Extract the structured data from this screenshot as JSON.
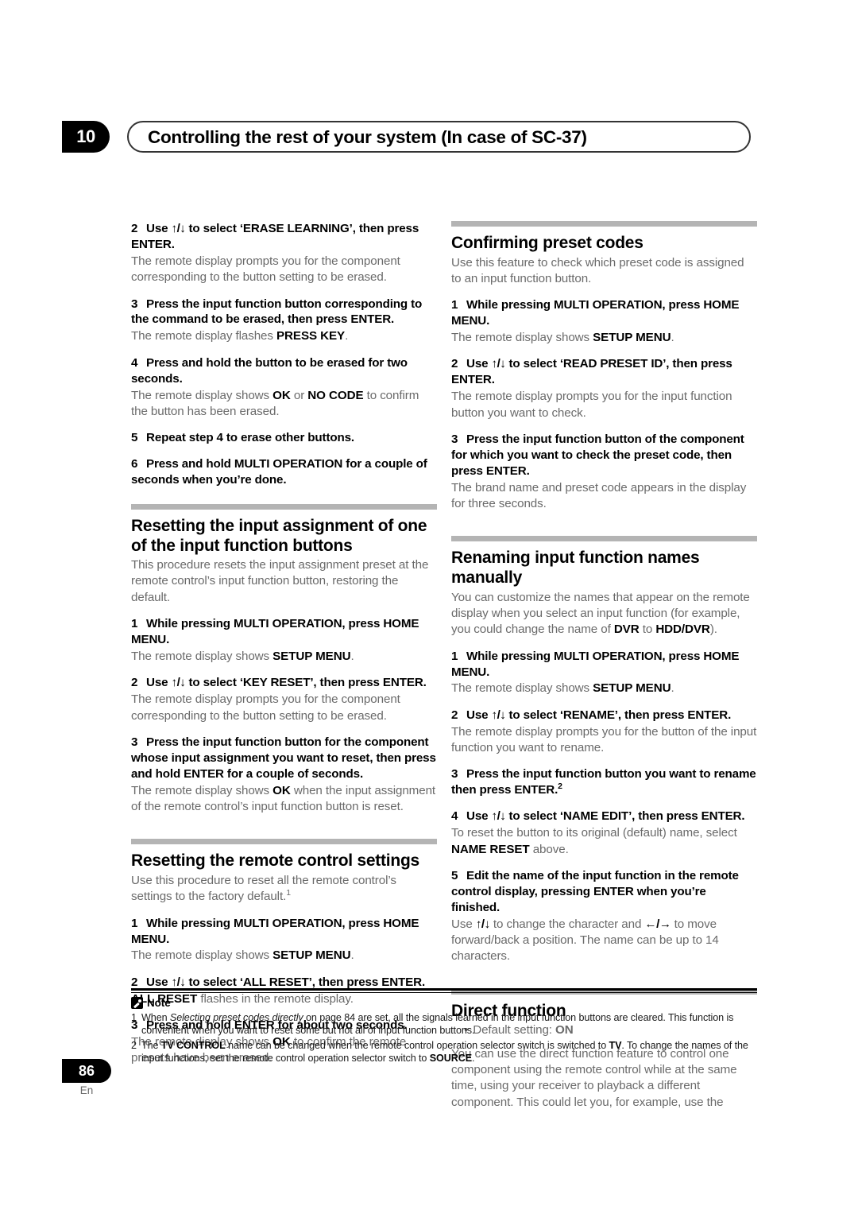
{
  "header": {
    "chapter_number": "10",
    "title": "Controlling the rest of your system (In case of SC-37)"
  },
  "left_column": {
    "steps_continued": [
      {
        "num": "2",
        "title_pre": "Use ",
        "arrows": "↑/↓",
        "title_post": " to select ‘ERASE LEARNING’, then press ENTER.",
        "body": "The remote display prompts you for the component corresponding to the button setting to be erased."
      },
      {
        "num": "3",
        "title": "Press the input function button corresponding to the command to be erased, then press ENTER.",
        "body_pre": "The remote display flashes ",
        "body_bold": "PRESS KEY",
        "body_post": "."
      },
      {
        "num": "4",
        "title": "Press and hold the button to be erased for two seconds.",
        "body_pre": "The remote display shows ",
        "body_bold1": "OK",
        "body_mid": " or ",
        "body_bold2": "NO CODE",
        "body_post": " to confirm the button has been erased."
      },
      {
        "num": "5",
        "title": "Repeat step 4 to erase other buttons."
      },
      {
        "num": "6",
        "title": "Press and hold MULTI OPERATION for a couple of seconds when you’re done."
      }
    ],
    "section_reset_input": {
      "title": "Resetting the input assignment of one of the input function buttons",
      "intro": "This procedure resets the input assignment preset at the remote control’s input function button, restoring the default.",
      "steps": [
        {
          "num": "1",
          "title": "While pressing MULTI OPERATION, press HOME MENU.",
          "body_pre": "The remote display shows ",
          "body_bold": "SETUP MENU",
          "body_post": "."
        },
        {
          "num": "2",
          "title_pre": "Use ",
          "arrows": "↑/↓",
          "title_post": " to select ‘KEY RESET’, then press ENTER.",
          "body": "The remote display prompts you for the component corresponding to the button setting to be erased."
        },
        {
          "num": "3",
          "title": "Press the input function button for the component whose input assignment you want to reset, then press and hold ENTER for a couple of seconds.",
          "body_pre": "The remote display shows ",
          "body_bold": "OK",
          "body_post": " when the input assignment of the remote control’s input function button is reset."
        }
      ]
    },
    "section_reset_remote": {
      "title": "Resetting the remote control settings",
      "intro_pre": "Use this procedure to reset all the remote control’s settings to the factory default.",
      "intro_sup": "1",
      "steps": [
        {
          "num": "1",
          "title": "While pressing MULTI OPERATION, press HOME MENU.",
          "body_pre": "The remote display shows ",
          "body_bold": "SETUP MENU",
          "body_post": "."
        },
        {
          "num": "2",
          "title_pre": "Use ",
          "arrows": "↑/↓",
          "title_post": " to select ‘ALL RESET’, then press ENTER.",
          "body_bold": "ALL RESET",
          "body_post": " flashes in the remote display."
        },
        {
          "num": "3",
          "title": "Press and hold ENTER for about two seconds.",
          "body_pre": "The remote display shows ",
          "body_bold": "OK",
          "body_post": " to confirm the remote presets have been erased."
        }
      ]
    }
  },
  "right_column": {
    "section_confirming": {
      "title": "Confirming preset codes",
      "intro": "Use this feature to check which preset code is assigned to an input function button.",
      "steps": [
        {
          "num": "1",
          "title": "While pressing MULTI OPERATION, press HOME MENU.",
          "body_pre": "The remote display shows ",
          "body_bold": "SETUP MENU",
          "body_post": "."
        },
        {
          "num": "2",
          "title_pre": "Use ",
          "arrows": "↑/↓",
          "title_post": " to select ‘READ PRESET ID’, then press ENTER.",
          "body": "The remote display prompts you for the input function button you want to check."
        },
        {
          "num": "3",
          "title": "Press the input function button of the component for which you want to check the preset code, then press ENTER.",
          "body": "The brand name and preset code appears in the display for three seconds."
        }
      ]
    },
    "section_renaming": {
      "title": "Renaming input function names manually",
      "intro_pre": "You can customize the names that appear on the remote display when you select an input function (for example, you could change the name of ",
      "intro_bold1": "DVR",
      "intro_mid": " to ",
      "intro_bold2": "HDD/DVR",
      "intro_post": ").",
      "steps": [
        {
          "num": "1",
          "title": "While pressing MULTI OPERATION, press HOME MENU.",
          "body_pre": "The remote display shows ",
          "body_bold": "SETUP MENU",
          "body_post": "."
        },
        {
          "num": "2",
          "title_pre": "Use ",
          "arrows": "↑/↓",
          "title_post": " to select ‘RENAME’, then press ENTER.",
          "body": "The remote display prompts you for the button of the input function you want to rename."
        },
        {
          "num": "3",
          "title": "Press the input function button you want to rename then press ENTER.",
          "title_sup": "2"
        },
        {
          "num": "4",
          "title_pre": "Use ",
          "arrows": "↑/↓",
          "title_post": " to select ‘NAME EDIT’, then press ENTER.",
          "body_pre": "To reset the button to its original (default) name, select ",
          "body_bold": "NAME RESET",
          "body_post": " above."
        },
        {
          "num": "5",
          "title": "Edit the name of the input function in the remote control display, pressing ENTER when you’re finished.",
          "body_pre": "Use ",
          "body_arrows1": "↑/↓",
          "body_mid": " to change the character and ",
          "body_arrows2": "←/→",
          "body_post": " to move forward/back a position. The name can be up to 14 characters."
        }
      ]
    },
    "section_direct": {
      "title": "Direct function",
      "bullet_pre": "Default setting: ",
      "bullet_bold": "ON",
      "body": "You can use the direct function feature to control one component using the remote control while at the same time, using your receiver to playback a different component. This could let you, for example, use the"
    }
  },
  "note": {
    "label": "Note",
    "footnotes": [
      {
        "num": "1",
        "pre": "When ",
        "italic": "Selecting preset codes directly",
        "post": " on page 84 are set, all the signals learned in the input function buttons are cleared. This function is convenient when you want to reset some but not all of input function buttons."
      },
      {
        "num": "2",
        "pre": "The ",
        "bold1": "TV CONTROL",
        "mid1": " name can be changed when the remote control operation selector switch is switched to ",
        "bold2": "TV",
        "mid2": ". To change the names of the input functions, set the remote control operation selector switch to ",
        "bold3": "SOURCE",
        "post": "."
      }
    ]
  },
  "footer": {
    "page_number": "86",
    "language": "En"
  }
}
